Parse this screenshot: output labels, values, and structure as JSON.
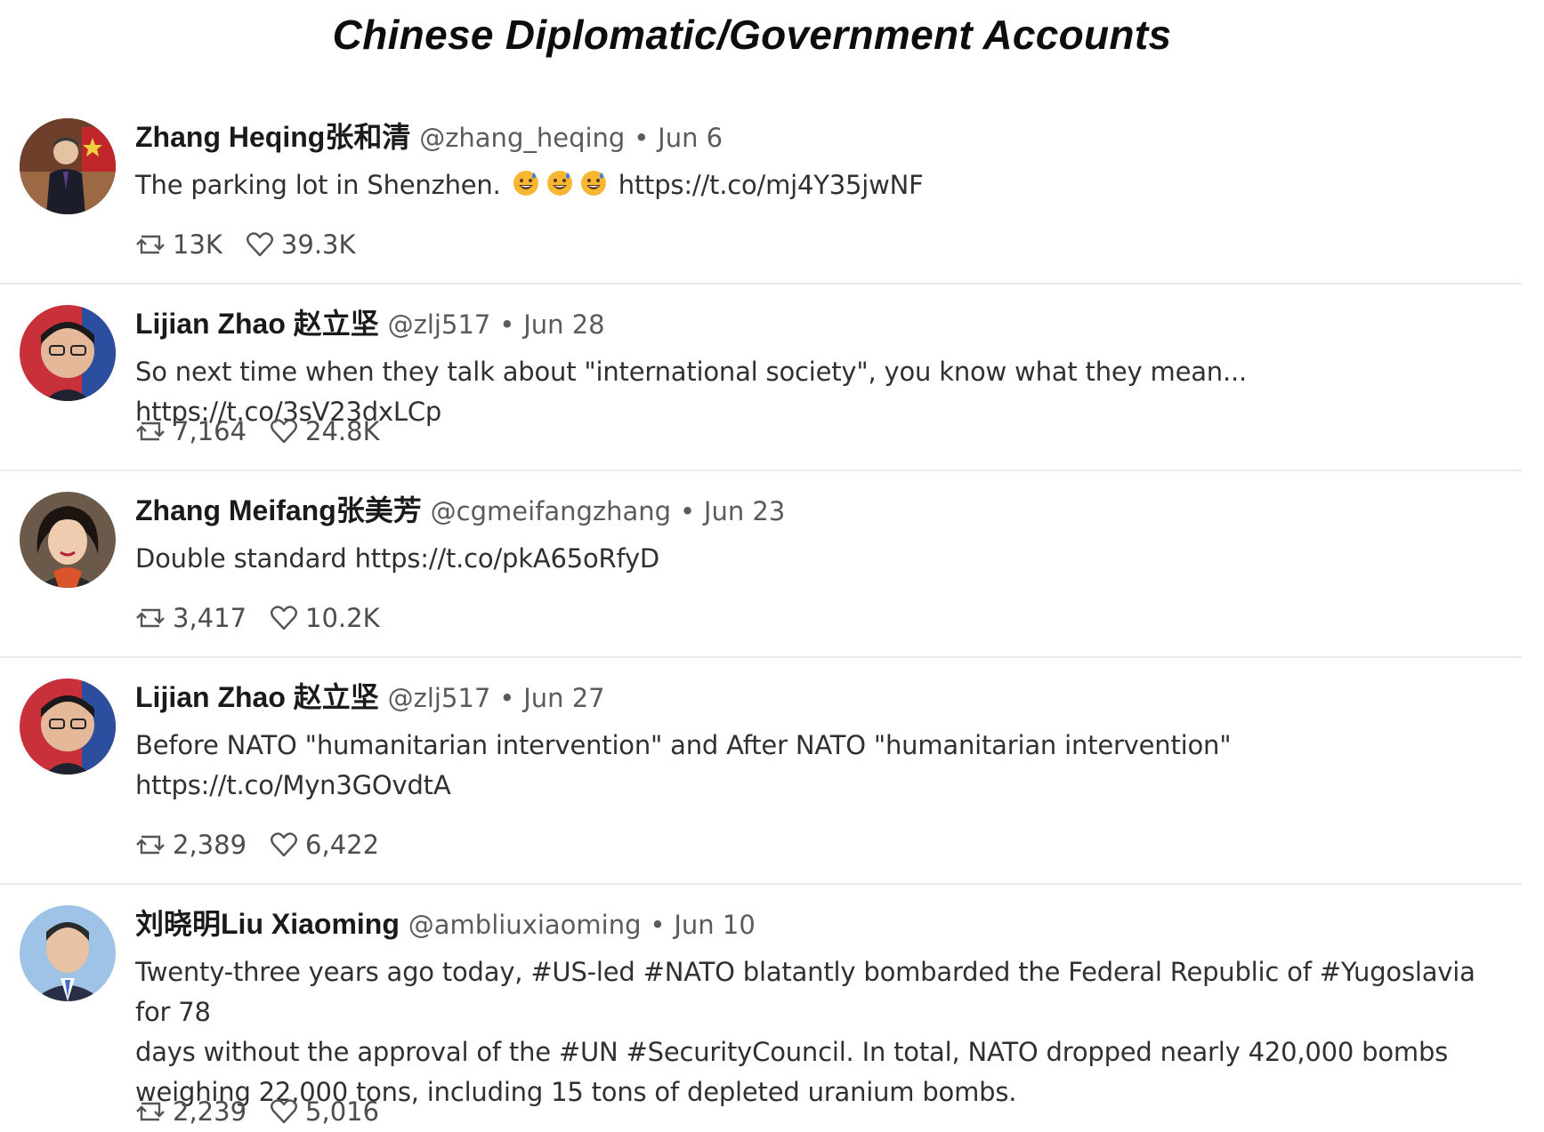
{
  "page_title": "Chinese Diplomatic/Government Accounts",
  "tweets": [
    {
      "display_name": "Zhang Heqing张和清",
      "handle": "@zhang_heqing",
      "separator": "•",
      "date": "Jun 6",
      "text_before_emoji": "The parking lot in Shenzhen.",
      "emoji_icons": [
        "grinning-sweat-emoji",
        "grinning-sweat-emoji",
        "grinning-sweat-emoji"
      ],
      "text_after_emoji": "https://t.co/mj4Y35jwNF",
      "retweets": "13K",
      "likes": "39.3K"
    },
    {
      "display_name": "Lijian Zhao 赵立坚",
      "handle": "@zlj517",
      "separator": "•",
      "date": "Jun 28",
      "text": "So next time when they talk about \"international society\", you know what they mean... https://t.co/3sV23dxLCp",
      "retweets": "7,164",
      "likes": "24.8K"
    },
    {
      "display_name": "Zhang Meifang张美芳",
      "handle": "@cgmeifangzhang",
      "separator": "•",
      "date": "Jun 23",
      "text": "Double standard https://t.co/pkA65oRfyD",
      "retweets": "3,417",
      "likes": "10.2K"
    },
    {
      "display_name": "Lijian Zhao 赵立坚",
      "handle": "@zlj517",
      "separator": "•",
      "date": "Jun 27",
      "text_line1": "Before NATO \"humanitarian intervention\" and After NATO \"humanitarian intervention\"",
      "text_line2": "https://t.co/Myn3GOvdtA",
      "retweets": "2,389",
      "likes": "6,422"
    },
    {
      "display_name": "刘晓明Liu Xiaoming",
      "handle": "@ambliuxiaoming",
      "separator": "•",
      "date": "Jun 10",
      "text_line1": "Twenty-three years ago today, #US-led #NATO blatantly bombarded the Federal Republic of #Yugoslavia for 78",
      "text_line2": "days without the approval of the #UN #SecurityCouncil. In total, NATO dropped nearly 420,000 bombs",
      "text_line3": "weighing 22,000 tons, including 15 tons of depleted uranium bombs.",
      "retweets": "2,239",
      "likes": "5,016"
    }
  ],
  "icons": {
    "retweet": "retweet-icon",
    "like": "heart-icon"
  },
  "colors": {
    "icon_stroke": "#555555",
    "divider": "#ebebeb",
    "handle": "#5b5b5b"
  }
}
